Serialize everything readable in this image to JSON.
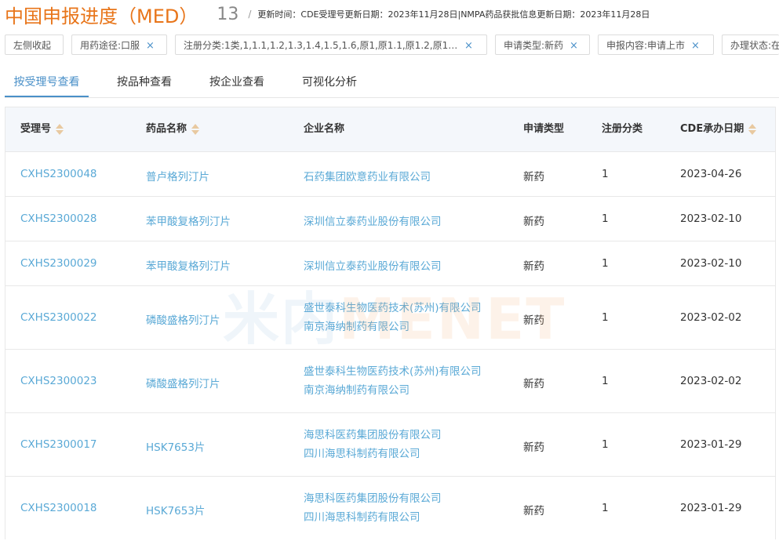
{
  "header": {
    "title": "中国申报进度（MED）",
    "count": "13",
    "separator": "/",
    "update_info": "更新时间：CDE受理号更新日期：2023年11月28日|NMPA药品获批信息更新日期：2023年11月28日"
  },
  "filters": [
    {
      "label": "左侧收起",
      "closable": false
    },
    {
      "label": "用药途径:口服",
      "closable": true
    },
    {
      "label": "注册分类:1类,1,1.1,1.2,1.3,1.4,1.5,1.6,原1,原1.1,原1.2,原1.5...",
      "closable": true
    },
    {
      "label": "申请类型:新药",
      "closable": true
    },
    {
      "label": "申报内容:申请上市",
      "closable": true
    },
    {
      "label": "办理状态:在",
      "closable": false
    }
  ],
  "close_glyph": "×",
  "tabs": [
    {
      "label": "按受理号查看",
      "active": true
    },
    {
      "label": "按品种查看",
      "active": false
    },
    {
      "label": "按企业查看",
      "active": false
    },
    {
      "label": "可视化分析",
      "active": false
    }
  ],
  "table": {
    "headers": [
      "受理号",
      "药品名称",
      "企业名称",
      "申请类型",
      "注册分类",
      "CDE承办日期"
    ],
    "rows": [
      {
        "id": "CXHS2300048",
        "drug": "普卢格列汀片",
        "companies": [
          "石药集团欧意药业有限公司"
        ],
        "type": "新药",
        "category": "1",
        "date": "2023-04-26"
      },
      {
        "id": "CXHS2300028",
        "drug": "苯甲酸复格列汀片",
        "companies": [
          "深圳信立泰药业股份有限公司"
        ],
        "type": "新药",
        "category": "1",
        "date": "2023-02-10"
      },
      {
        "id": "CXHS2300029",
        "drug": "苯甲酸复格列汀片",
        "companies": [
          "深圳信立泰药业股份有限公司"
        ],
        "type": "新药",
        "category": "1",
        "date": "2023-02-10"
      },
      {
        "id": "CXHS2300022",
        "drug": "磷酸盛格列汀片",
        "companies": [
          "盛世泰科生物医药技术(苏州)有限公司",
          "南京海纳制药有限公司"
        ],
        "type": "新药",
        "category": "1",
        "date": "2023-02-02"
      },
      {
        "id": "CXHS2300023",
        "drug": "磷酸盛格列汀片",
        "companies": [
          "盛世泰科生物医药技术(苏州)有限公司",
          "南京海纳制药有限公司"
        ],
        "type": "新药",
        "category": "1",
        "date": "2023-02-02"
      },
      {
        "id": "CXHS2300017",
        "drug": "HSK7653片",
        "companies": [
          "海思科医药集团股份有限公司",
          "四川海思科制药有限公司"
        ],
        "type": "新药",
        "category": "1",
        "date": "2023-01-29"
      },
      {
        "id": "CXHS2300018",
        "drug": "HSK7653片",
        "companies": [
          "海思科医药集团股份有限公司",
          "四川海思科制药有限公司"
        ],
        "type": "新药",
        "category": "1",
        "date": "2023-01-29"
      }
    ]
  },
  "watermark": {
    "part1": "米内",
    "part2": "MENET"
  }
}
